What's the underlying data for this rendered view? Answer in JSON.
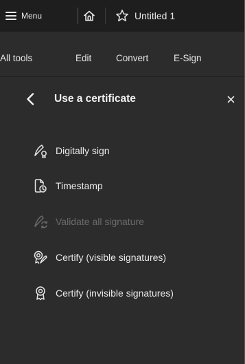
{
  "topbar": {
    "menu_label": "Menu",
    "document_title": "Untitled 1"
  },
  "tools": {
    "items": [
      "All tools",
      "Edit",
      "Convert",
      "E-Sign"
    ]
  },
  "panel": {
    "title": "Use a certificate",
    "close_glyph": "×",
    "items": [
      {
        "label": "Digitally sign",
        "icon": "digital-sign-icon",
        "enabled": true
      },
      {
        "label": "Timestamp",
        "icon": "timestamp-icon",
        "enabled": true
      },
      {
        "label": "Validate all signature",
        "icon": "validate-signature-icon",
        "enabled": false
      },
      {
        "label": "Certify (visible signatures)",
        "icon": "certify-visible-icon",
        "enabled": true
      },
      {
        "label": "Certify (invisible signatures)",
        "icon": "certify-invisible-icon",
        "enabled": true
      }
    ]
  },
  "colors": {
    "background": "#2c2c2c",
    "topbar": "#1e1e1e",
    "text": "#eaeaea",
    "disabled_text": "#6b6b6b"
  }
}
